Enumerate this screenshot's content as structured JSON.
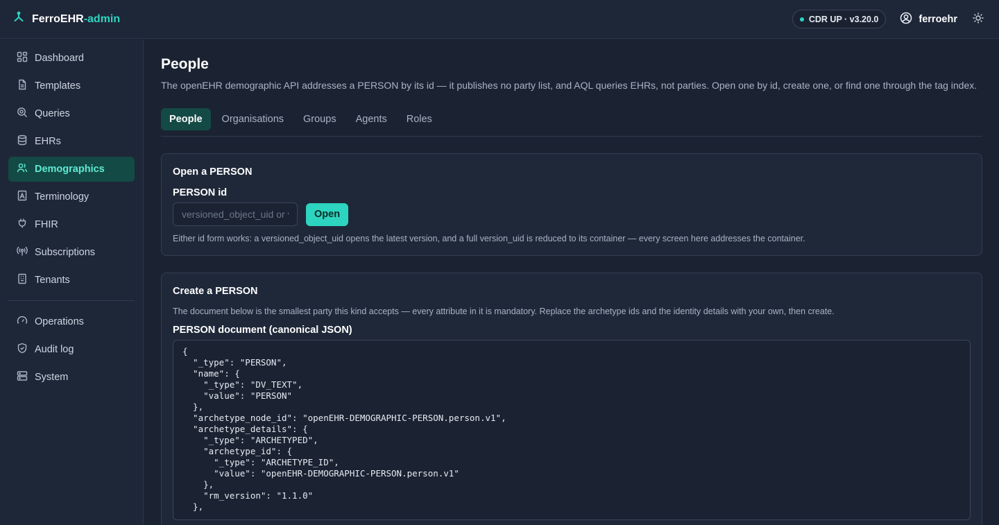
{
  "app": {
    "name": "FerroEHR",
    "name_suffix": "-admin"
  },
  "header": {
    "status_badge": "CDR UP · v3.20.0",
    "username": "ferroehr",
    "colors": {
      "accent": "#2dd4bf",
      "status_dot": "#2dd4bf"
    }
  },
  "sidebar": {
    "items": [
      {
        "label": "Dashboard",
        "icon": "dashboard-icon"
      },
      {
        "label": "Templates",
        "icon": "document-icon"
      },
      {
        "label": "Queries",
        "icon": "search-icon"
      },
      {
        "label": "EHRs",
        "icon": "database-icon"
      },
      {
        "label": "Demographics",
        "icon": "users-icon",
        "active": true
      },
      {
        "label": "Terminology",
        "icon": "book-icon"
      },
      {
        "label": "FHIR",
        "icon": "plug-icon"
      },
      {
        "label": "Subscriptions",
        "icon": "radio-icon"
      },
      {
        "label": "Tenants",
        "icon": "building-icon"
      }
    ],
    "secondary": [
      {
        "label": "Operations",
        "icon": "gauge-icon"
      },
      {
        "label": "Audit log",
        "icon": "shield-icon"
      },
      {
        "label": "System",
        "icon": "server-icon"
      }
    ]
  },
  "page": {
    "title": "People",
    "description": "The openEHR demographic API addresses a PERSON by its id — it publishes no party list, and AQL queries EHRs, not parties. Open one by id, create one, or find one through the tag index."
  },
  "tabs": [
    {
      "label": "People",
      "active": true
    },
    {
      "label": "Organisations"
    },
    {
      "label": "Groups"
    },
    {
      "label": "Agents"
    },
    {
      "label": "Roles"
    }
  ],
  "open_card": {
    "title": "Open a PERSON",
    "field_label": "PERSON id",
    "input_placeholder": "versioned_object_uid or version_uid",
    "input_value": "",
    "button_label": "Open",
    "help": "Either id form works: a versioned_object_uid opens the latest version, and a full version_uid is reduced to its container — every screen here addresses the container."
  },
  "create_card": {
    "title": "Create a PERSON",
    "help": "The document below is the smallest party this kind accepts — every attribute in it is mandatory. Replace the archetype ids and the identity details with your own, then create.",
    "field_label": "PERSON document (canonical JSON)",
    "document": "{\n  \"_type\": \"PERSON\",\n  \"name\": {\n    \"_type\": \"DV_TEXT\",\n    \"value\": \"PERSON\"\n  },\n  \"archetype_node_id\": \"openEHR-DEMOGRAPHIC-PERSON.person.v1\",\n  \"archetype_details\": {\n    \"_type\": \"ARCHETYPED\",\n    \"archetype_id\": {\n      \"_type\": \"ARCHETYPE_ID\",\n      \"value\": \"openEHR-DEMOGRAPHIC-PERSON.person.v1\"\n    },\n    \"rm_version\": \"1.1.0\"\n  },"
  }
}
